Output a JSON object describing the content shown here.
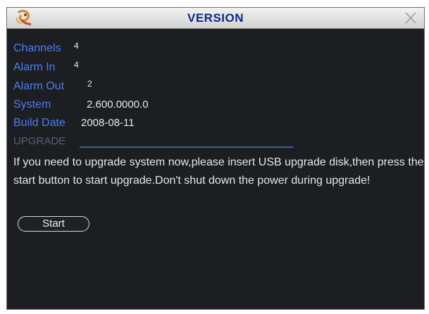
{
  "window": {
    "title": "VERSION"
  },
  "info": {
    "channels_label": "Channels",
    "channels_value": "4",
    "alarm_in_label": "Alarm In",
    "alarm_in_value": "4",
    "alarm_out_label": "Alarm Out",
    "alarm_out_value": "2",
    "system_label": "System",
    "system_value": "2.600.0000.0",
    "build_date_label": "Build Date",
    "build_date_value": "2008-08-11"
  },
  "upgrade": {
    "section_label": "UPGRADE",
    "message": "If you need to upgrade system now,please insert USB upgrade disk,then press the start button to start upgrade.Don't shut down the power during upgrade!",
    "start_label": "Start"
  },
  "colors": {
    "label_blue": "#4d7df0",
    "title_blue": "#0a2a8c",
    "background": "#1c1e22"
  },
  "icons": {
    "logo": "app-logo-icon",
    "close": "close-icon"
  }
}
